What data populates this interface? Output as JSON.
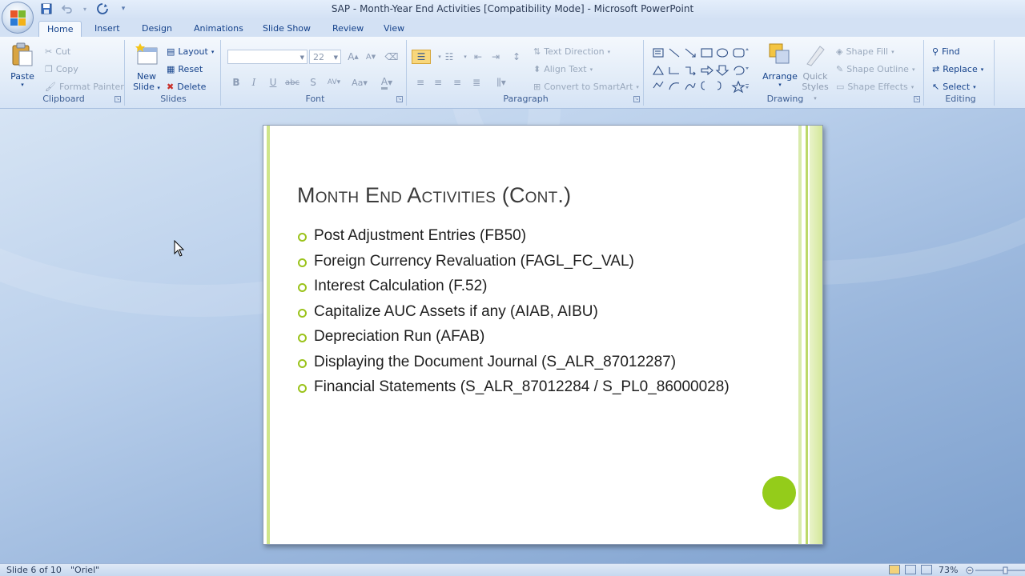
{
  "window": {
    "title": "SAP - Month-Year End Activities [Compatibility Mode] - Microsoft PowerPoint"
  },
  "tabs": [
    {
      "label": "Home",
      "active": true
    },
    {
      "label": "Insert"
    },
    {
      "label": "Design"
    },
    {
      "label": "Animations"
    },
    {
      "label": "Slide Show"
    },
    {
      "label": "Review"
    },
    {
      "label": "View"
    }
  ],
  "ribbon": {
    "clipboard": {
      "label": "Clipboard",
      "paste": "Paste",
      "cut": "Cut",
      "copy": "Copy",
      "format_painter": "Format Painter"
    },
    "slides": {
      "label": "Slides",
      "new_slide_line1": "New",
      "new_slide_line2": "Slide",
      "layout": "Layout",
      "reset": "Reset",
      "delete": "Delete"
    },
    "font": {
      "label": "Font",
      "size": "22"
    },
    "paragraph": {
      "label": "Paragraph",
      "text_direction": "Text Direction",
      "align_text": "Align Text",
      "convert_smartart": "Convert to SmartArt"
    },
    "drawing": {
      "label": "Drawing",
      "arrange": "Arrange",
      "quick_styles_line1": "Quick",
      "quick_styles_line2": "Styles",
      "shape_fill": "Shape Fill",
      "shape_outline": "Shape Outline",
      "shape_effects": "Shape Effects"
    },
    "editing": {
      "label": "Editing",
      "find": "Find",
      "replace": "Replace",
      "select": "Select"
    }
  },
  "slide": {
    "title": "Month End Activities (Cont.)",
    "bullets": [
      "Post Adjustment  Entries (FB50)",
      "Foreign Currency Revaluation (FAGL_FC_VAL)",
      "Interest Calculation (F.52)",
      "Capitalize AUC Assets if any (AIAB, AIBU)",
      "Depreciation Run (AFAB)",
      "Displaying the Document Journal (S_ALR_87012287)",
      "Financial Statements (S_ALR_87012284 / S_PL0_86000028)"
    ],
    "accent_color": "#94cc1a"
  },
  "status": {
    "slide_info": "Slide 6 of 10",
    "theme": "\"Oriel\"",
    "zoom": "73%"
  }
}
